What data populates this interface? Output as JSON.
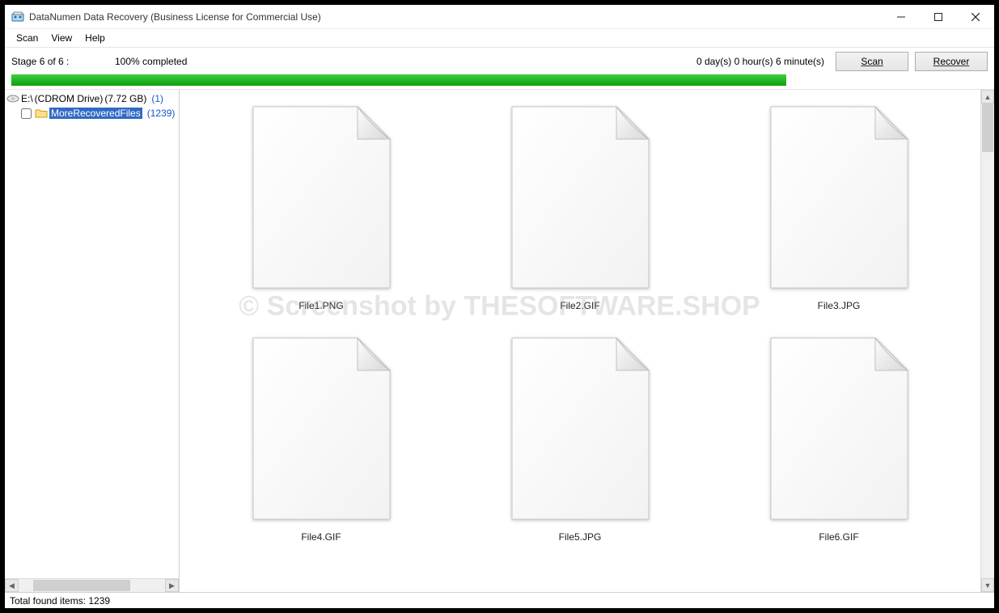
{
  "titlebar": {
    "title": "DataNumen Data Recovery (Business License for Commercial Use)"
  },
  "menu": {
    "items": [
      "Scan",
      "View",
      "Help"
    ]
  },
  "progress": {
    "stage": "Stage 6 of 6 :",
    "percent_text": "100% completed",
    "percent_value": 100,
    "elapsed": "0 day(s) 0 hour(s) 6 minute(s)",
    "scan_label": "Scan",
    "recover_label": "Recover"
  },
  "sidebar": {
    "drive": {
      "path": "E:\\",
      "desc": "(CDROM Drive)",
      "size": "(7.72 GB)",
      "count": "(1)"
    },
    "folder": {
      "name": "MoreRecoveredFiles",
      "count": "(1239)"
    }
  },
  "files": [
    {
      "name": "File1.PNG"
    },
    {
      "name": "File2.GIF"
    },
    {
      "name": "File3.JPG"
    },
    {
      "name": "File4.GIF"
    },
    {
      "name": "File5.JPG"
    },
    {
      "name": "File6.GIF"
    }
  ],
  "statusbar": {
    "text": "Total found items: 1239"
  },
  "watermark": "© Screenshot by THESOFTWARE.SHOP"
}
